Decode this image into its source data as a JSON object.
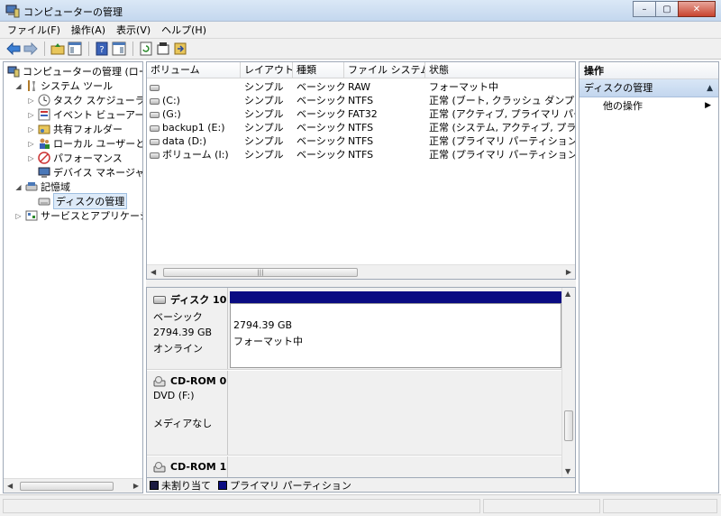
{
  "window": {
    "title": "コンピューターの管理",
    "minimize_glyph": "–",
    "maximize_glyph": "▢",
    "close_glyph": "✕"
  },
  "menu": [
    "ファイル(F)",
    "操作(A)",
    "表示(V)",
    "ヘルプ(H)"
  ],
  "toolbar": {
    "icons": [
      "back-icon",
      "forward-icon",
      "up-folder-icon",
      "show-hide-tree-icon",
      "help-icon",
      "show-hide-action-pane-icon",
      "refresh-icon",
      "properties-icon",
      "export-icon"
    ]
  },
  "tree": {
    "items": [
      {
        "label": "コンピューターの管理 (ローカル)",
        "level": 0,
        "toggle": "",
        "icon": "computer-management-icon"
      },
      {
        "label": "システム ツール",
        "level": 1,
        "toggle": "◢",
        "icon": "system-tools-icon"
      },
      {
        "label": "タスク スケジューラ",
        "level": 2,
        "toggle": "▷",
        "icon": "task-scheduler-icon"
      },
      {
        "label": "イベント ビューアー",
        "level": 2,
        "toggle": "▷",
        "icon": "event-viewer-icon"
      },
      {
        "label": "共有フォルダー",
        "level": 2,
        "toggle": "▷",
        "icon": "shared-folders-icon"
      },
      {
        "label": "ローカル ユーザーとグループ",
        "level": 2,
        "toggle": "▷",
        "icon": "local-users-icon"
      },
      {
        "label": "パフォーマンス",
        "level": 2,
        "toggle": "▷",
        "icon": "performance-icon"
      },
      {
        "label": "デバイス マネージャー",
        "level": 2,
        "toggle": "",
        "icon": "device-manager-icon"
      },
      {
        "label": "記憶域",
        "level": 1,
        "toggle": "◢",
        "icon": "storage-icon"
      },
      {
        "label": "ディスクの管理",
        "level": 2,
        "toggle": "",
        "icon": "disk-management-icon",
        "selected": true
      },
      {
        "label": "サービスとアプリケーション",
        "level": 1,
        "toggle": "▷",
        "icon": "services-apps-icon"
      }
    ]
  },
  "volumes": {
    "columns": [
      "ボリューム",
      "レイアウト",
      "種類",
      "ファイル システム",
      "状態"
    ],
    "rows": [
      {
        "volume": "",
        "layout": "シンプル",
        "type": "ベーシック",
        "fs": "RAW",
        "status": "フォーマット中"
      },
      {
        "volume": "(C:)",
        "layout": "シンプル",
        "type": "ベーシック",
        "fs": "NTFS",
        "status": "正常 (ブート, クラッシュ ダンプ, プライ"
      },
      {
        "volume": "(G:)",
        "layout": "シンプル",
        "type": "ベーシック",
        "fs": "FAT32",
        "status": "正常 (アクティブ, プライマリ パーティ"
      },
      {
        "volume": "backup1 (E:)",
        "layout": "シンプル",
        "type": "ベーシック",
        "fs": "NTFS",
        "status": "正常 (システム, アクティブ, プライマリ"
      },
      {
        "volume": "data (D:)",
        "layout": "シンプル",
        "type": "ベーシック",
        "fs": "NTFS",
        "status": "正常 (プライマリ パーティション)"
      },
      {
        "volume": "ボリューム (I:)",
        "layout": "シンプル",
        "type": "ベーシック",
        "fs": "NTFS",
        "status": "正常 (プライマリ パーティション)"
      }
    ]
  },
  "disks": [
    {
      "name": "ディスク 10",
      "kind": "ベーシック",
      "size": "2794.39 GB",
      "state": "オンライン",
      "icon": "hard-disk-icon",
      "partition": {
        "size": "2794.39 GB",
        "status": "フォーマット中",
        "band_color": "#0a0c82"
      }
    },
    {
      "name": "CD-ROM 0",
      "kind": "DVD (F:)",
      "size": "",
      "state": "メディアなし",
      "icon": "cd-rom-icon"
    },
    {
      "name": "CD-ROM 1",
      "icon": "cd-rom-icon"
    }
  ],
  "legend": [
    {
      "label": "未割り当て",
      "color": "#1a1a40"
    },
    {
      "label": "プライマリ パーティション",
      "color": "#0a0c82"
    }
  ],
  "actions": {
    "header": "操作",
    "section": "ディスクの管理",
    "items": [
      "他の操作"
    ]
  },
  "scroll_glyphs": {
    "left": "◀",
    "right": "▶",
    "up": "▲",
    "down": "▼",
    "grip": "|||"
  }
}
